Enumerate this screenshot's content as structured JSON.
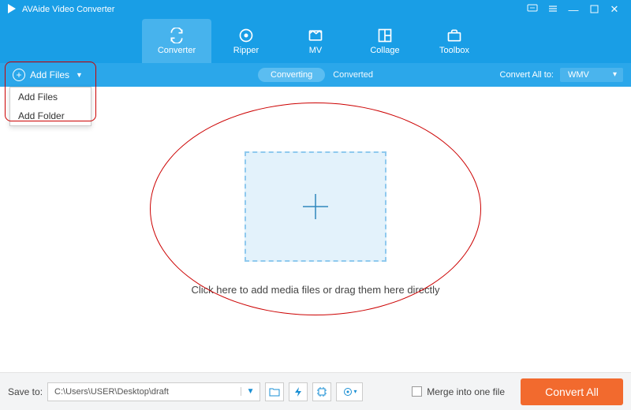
{
  "title": "AVAide Video Converter",
  "toolbar": {
    "tabs": [
      {
        "label": "Converter"
      },
      {
        "label": "Ripper"
      },
      {
        "label": "MV"
      },
      {
        "label": "Collage"
      },
      {
        "label": "Toolbox"
      }
    ]
  },
  "subbar": {
    "add_files": "Add Files",
    "converting": "Converting",
    "converted": "Converted",
    "convert_all_to": "Convert All to:",
    "format": "WMV"
  },
  "dropdown": {
    "item1": "Add Files",
    "item2": "Add Folder"
  },
  "main": {
    "drop_text": "Click here to add media files or drag them here directly"
  },
  "bottom": {
    "save_to": "Save to:",
    "path": "C:\\Users\\USER\\Desktop\\draft",
    "merge": "Merge into one file",
    "convert_all": "Convert All"
  }
}
